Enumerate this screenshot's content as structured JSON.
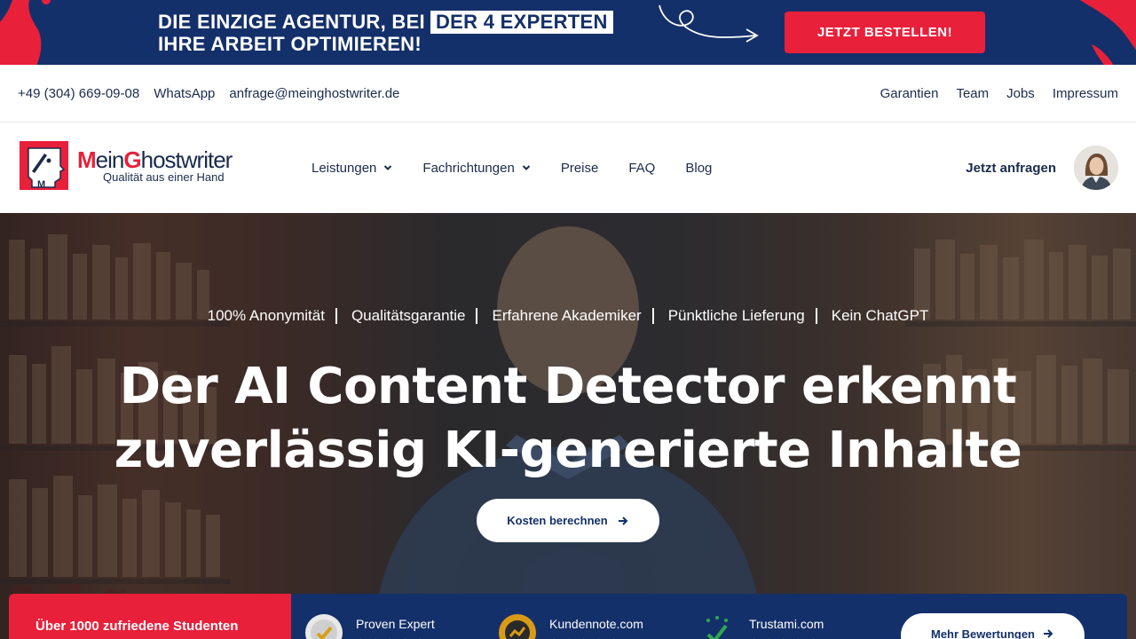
{
  "promo": {
    "line1": "DIE EINZIGE AGENTUR, BEI",
    "highlight": "DER 4 EXPERTEN",
    "line2": "IHRE ARBEIT OPTIMIEREN!",
    "cta": "JETZT BESTELLEN!",
    "colors": {
      "background": "#14306a",
      "accent": "#e8203a"
    }
  },
  "contact": {
    "phone": "+49 (304) 669-09-08",
    "whatsapp": "WhatsApp",
    "email": "anfrage@meinghostwriter.de",
    "links": [
      "Garantien",
      "Team",
      "Jobs",
      "Impressum"
    ]
  },
  "logo": {
    "brand_red_1": "M",
    "brand_blue_1": "ein",
    "brand_red_2": "G",
    "brand_blue_2": "hostwriter",
    "tagline": "Qualität aus einer Hand"
  },
  "nav": {
    "items": [
      {
        "label": "Leistungen",
        "dropdown": true
      },
      {
        "label": "Fachrichtungen",
        "dropdown": true
      },
      {
        "label": "Preise",
        "dropdown": false
      },
      {
        "label": "FAQ",
        "dropdown": false
      },
      {
        "label": "Blog",
        "dropdown": false
      }
    ],
    "inquire": "Jetzt anfragen",
    "avatar_icon": "user-avatar-icon"
  },
  "hero": {
    "badges": [
      "100% Anonymität",
      "Qualitätsgarantie",
      "Erfahrene Akademiker",
      "Pünktliche Lieferung",
      "Kein ChatGPT"
    ],
    "title_line1": "Der AI Content Detector erkennt",
    "title_line2": "zuverlässig KI-generierte Inhalte",
    "cta": "Kosten berechnen"
  },
  "ratings": {
    "headline": "Über 1000 zufriedene Studenten",
    "sources": [
      {
        "name": "Proven Expert",
        "icon": "proven-expert-seal-icon"
      },
      {
        "name": "Kundennote.com",
        "icon": "kundennote-seal-icon"
      },
      {
        "name": "Trustami.com",
        "icon": "trustami-seal-icon"
      }
    ],
    "stars": "★★★★★",
    "more": "Mehr Bewertungen"
  }
}
